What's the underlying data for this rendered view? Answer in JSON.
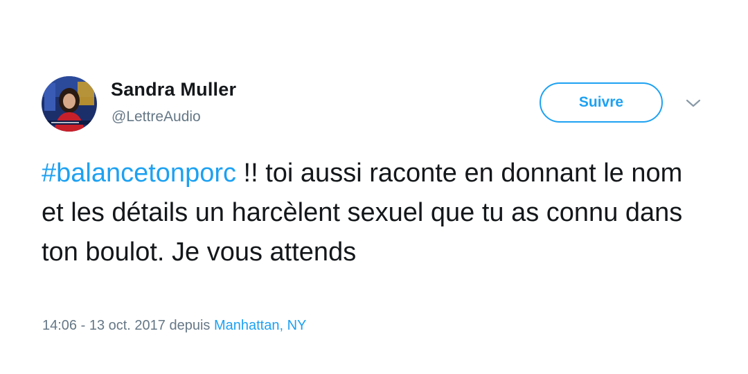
{
  "user": {
    "name": "Sandra Muller",
    "handle": "@LettreAudio",
    "avatar_icon": "profile-photo"
  },
  "actions": {
    "follow_label": "Suivre",
    "more_icon": "chevron-down-icon"
  },
  "tweet": {
    "hashtag": "#balancetonporc",
    "text": " !!  toi aussi raconte en donnant le nom et les détails un harcèlent sexuel que tu as connu dans ton boulot. Je vous attends"
  },
  "meta": {
    "time_date": "14:06 - 13 oct. 2017 depuis ",
    "location": "Manhattan, NY"
  },
  "colors": {
    "link": "#1da1f2",
    "text": "#14171a",
    "secondary": "#657786"
  }
}
